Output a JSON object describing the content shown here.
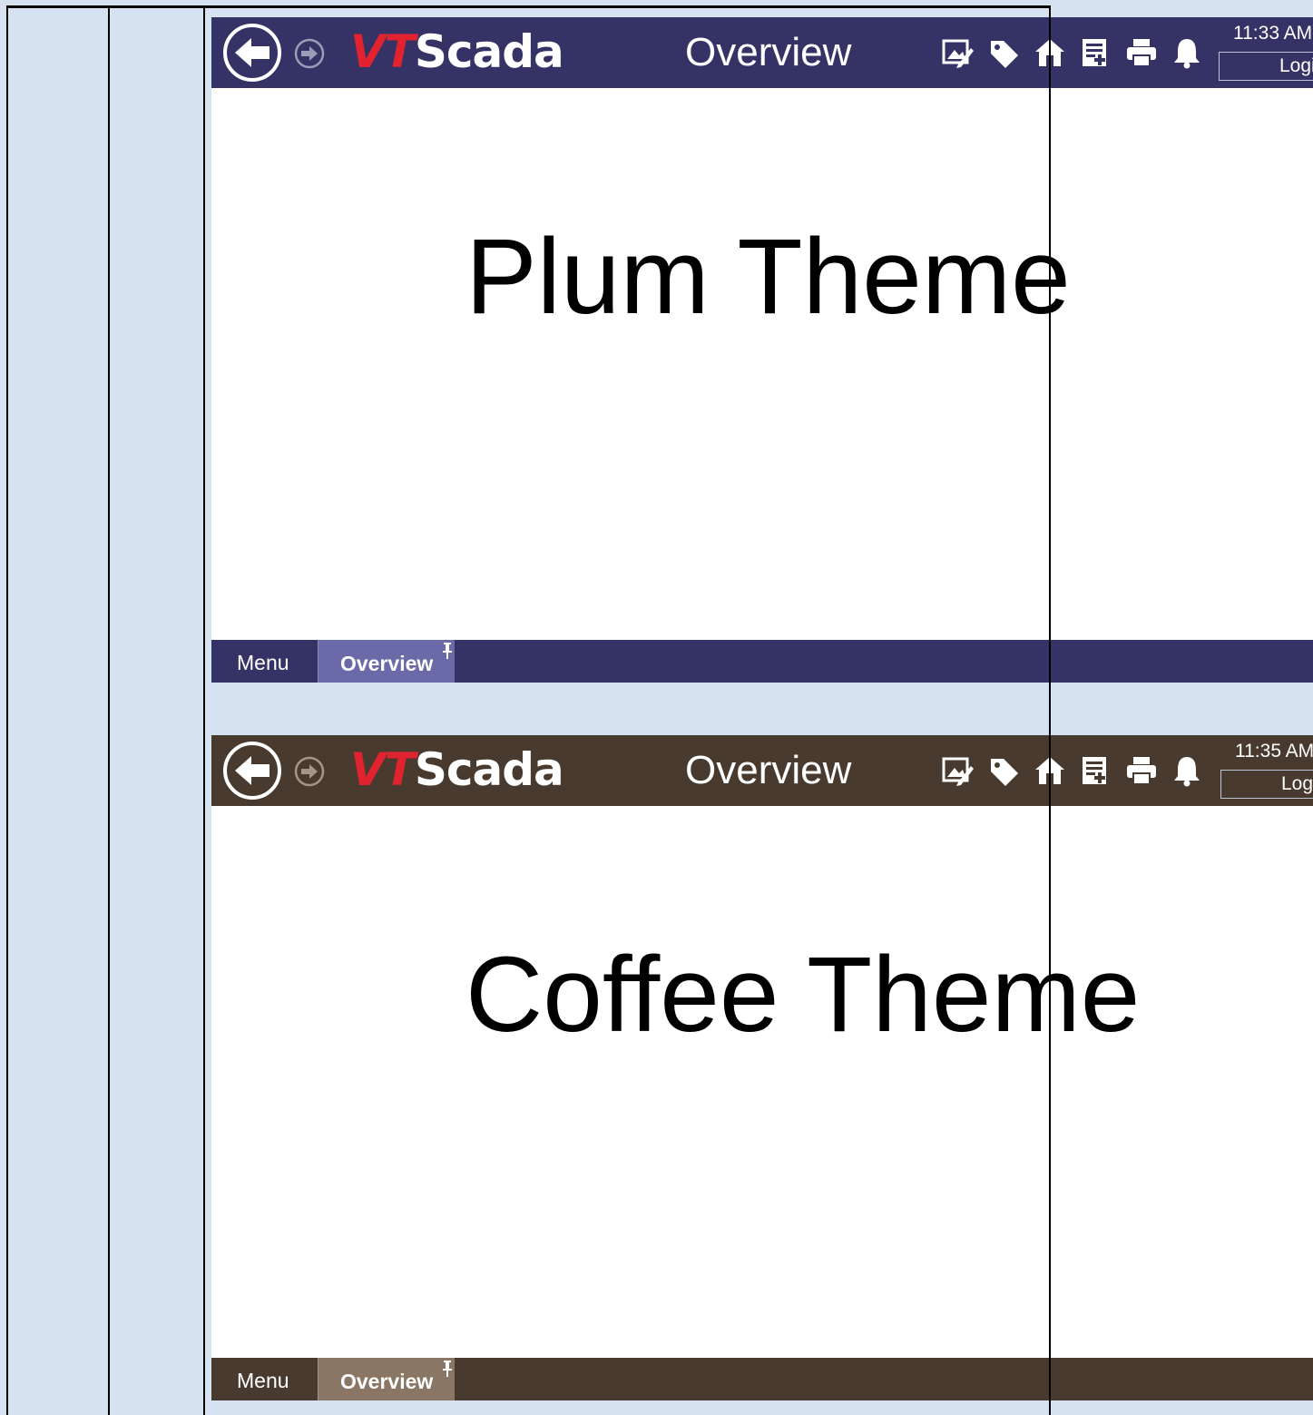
{
  "logo": {
    "vt": "VT",
    "scada": "Scada"
  },
  "panels": [
    {
      "theme": "plum",
      "page_title": "Overview",
      "time": "11:33 AM",
      "login_label": "Login",
      "heading": "Plum Theme",
      "tabs": {
        "menu": "Menu",
        "overview": "Overview"
      },
      "colors": {
        "bar": "#353366",
        "active_tab": "#6a6aa8"
      }
    },
    {
      "theme": "coffee",
      "page_title": "Overview",
      "time": "11:35 AM",
      "login_label": "Login",
      "heading": "Coffee Theme",
      "tabs": {
        "menu": "Menu",
        "overview": "Overview"
      },
      "colors": {
        "bar": "#483a2e",
        "active_tab": "#8a7665"
      }
    }
  ],
  "icons": [
    "back-arrow-icon",
    "forward-arrow-icon",
    "edit-display-icon",
    "tag-icon",
    "site-home-icon",
    "report-icon",
    "print-icon",
    "alarm-bell-icon",
    "pin-icon"
  ]
}
